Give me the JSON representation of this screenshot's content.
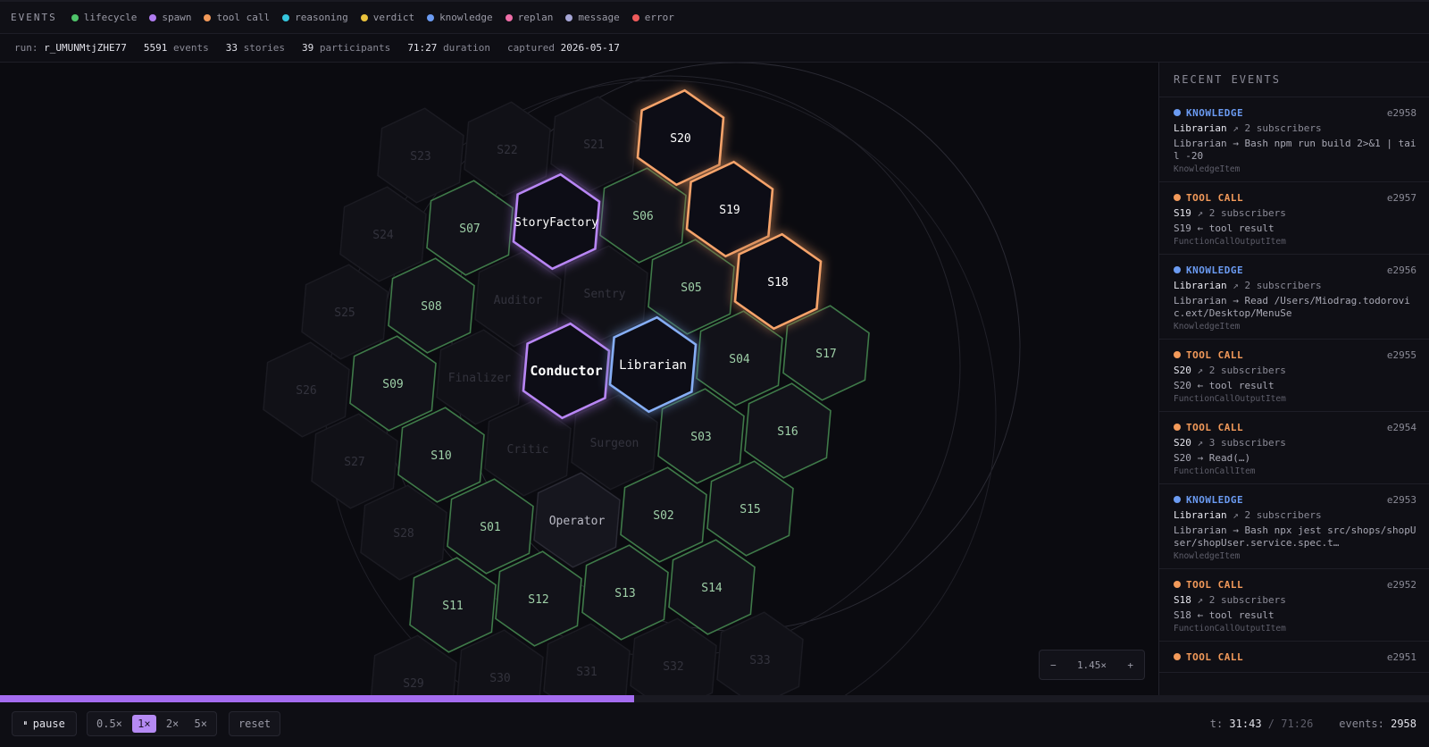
{
  "legend": {
    "title": "EVENTS",
    "items": [
      {
        "label": "lifecycle",
        "color": "#4fc46a"
      },
      {
        "label": "spawn",
        "color": "#b07cf0"
      },
      {
        "label": "tool call",
        "color": "#f39a5a"
      },
      {
        "label": "reasoning",
        "color": "#35c6dd"
      },
      {
        "label": "verdict",
        "color": "#e9c23c"
      },
      {
        "label": "knowledge",
        "color": "#6b9bf2"
      },
      {
        "label": "replan",
        "color": "#ef6ea8"
      },
      {
        "label": "message",
        "color": "#a6a6d6"
      },
      {
        "label": "error",
        "color": "#ef5b5b"
      }
    ]
  },
  "meta": {
    "run_label": "run:",
    "run_id": "r_UMUNMtjZHE77",
    "events_count": "5591",
    "events_label": "events",
    "stories_count": "33",
    "stories_label": "stories",
    "participants_count": "39",
    "participants_label": "participants",
    "duration_value": "71:27",
    "duration_label": "duration",
    "captured_label": "captured",
    "captured_date": "2026-05-17"
  },
  "graph": {
    "nodes": [
      {
        "label": "S23",
        "state": "ghost"
      },
      {
        "label": "S22",
        "state": "ghost"
      },
      {
        "label": "S21",
        "state": "ghost"
      },
      {
        "label": "S20",
        "state": "tool"
      },
      {
        "label": "S24",
        "state": "ghost"
      },
      {
        "label": "S07",
        "state": "active"
      },
      {
        "label": "StoryFactory",
        "state": "spawn"
      },
      {
        "label": "S06",
        "state": "active"
      },
      {
        "label": "S19",
        "state": "tool"
      },
      {
        "label": "S25",
        "state": "ghost"
      },
      {
        "label": "S08",
        "state": "active"
      },
      {
        "label": "Auditor",
        "state": "ghost"
      },
      {
        "label": "Sentry",
        "state": "ghost"
      },
      {
        "label": "S05",
        "state": "active"
      },
      {
        "label": "S18",
        "state": "tool"
      },
      {
        "label": "S26",
        "state": "ghost"
      },
      {
        "label": "S09",
        "state": "active"
      },
      {
        "label": "Finalizer",
        "state": "ghost"
      },
      {
        "label": "Conductor",
        "state": "spawn"
      },
      {
        "label": "Librarian",
        "state": "knowledge"
      },
      {
        "label": "S04",
        "state": "active"
      },
      {
        "label": "S17",
        "state": "active"
      },
      {
        "label": "S27",
        "state": "ghost"
      },
      {
        "label": "S10",
        "state": "active"
      },
      {
        "label": "Critic",
        "state": "ghost"
      },
      {
        "label": "Surgeon",
        "state": "ghost"
      },
      {
        "label": "S03",
        "state": "active"
      },
      {
        "label": "S16",
        "state": "active"
      },
      {
        "label": "S28",
        "state": "ghost"
      },
      {
        "label": "S01",
        "state": "active"
      },
      {
        "label": "Operator",
        "state": "neutral"
      },
      {
        "label": "S02",
        "state": "active"
      },
      {
        "label": "S15",
        "state": "active"
      },
      {
        "label": "S11",
        "state": "active"
      },
      {
        "label": "S12",
        "state": "active"
      },
      {
        "label": "S13",
        "state": "active"
      },
      {
        "label": "S14",
        "state": "active"
      },
      {
        "label": "S29",
        "state": "ghost"
      },
      {
        "label": "S30",
        "state": "ghost"
      },
      {
        "label": "S31",
        "state": "ghost"
      },
      {
        "label": "S32",
        "state": "ghost"
      },
      {
        "label": "S33",
        "state": "ghost"
      }
    ]
  },
  "zoom": {
    "minus": "−",
    "level": "1.45×",
    "plus": "+"
  },
  "recent": {
    "title": "RECENT EVENTS",
    "events": [
      {
        "kind": "KNOWLEDGE",
        "color": "#6b9bf2",
        "id": "e2958",
        "actor": "Librarian",
        "subs": "↗ 2 subscribers",
        "text": "Librarian → Bash npm run build 2>&1 | tail -20",
        "type": "KnowledgeItem",
        "clip": false
      },
      {
        "kind": "TOOL CALL",
        "color": "#f39a5a",
        "id": "e2957",
        "actor": "S19",
        "subs": "↗ 2 subscribers",
        "text": "S19 ← tool result",
        "type": "FunctionCallOutputItem",
        "clip": false
      },
      {
        "kind": "KNOWLEDGE",
        "color": "#6b9bf2",
        "id": "e2956",
        "actor": "Librarian",
        "subs": "↗ 2 subscribers",
        "text": "Librarian → Read /Users/Miodrag.todorovic.ext/Desktop/MenuSe",
        "type": "KnowledgeItem",
        "clip": false
      },
      {
        "kind": "TOOL CALL",
        "color": "#f39a5a",
        "id": "e2955",
        "actor": "S20",
        "subs": "↗ 2 subscribers",
        "text": "S20 ← tool result",
        "type": "FunctionCallOutputItem",
        "clip": false
      },
      {
        "kind": "TOOL CALL",
        "color": "#f39a5a",
        "id": "e2954",
        "actor": "S20",
        "subs": "↗ 3 subscribers",
        "text": "S20 → Read(…)",
        "type": "FunctionCallItem",
        "clip": false
      },
      {
        "kind": "KNOWLEDGE",
        "color": "#6b9bf2",
        "id": "e2953",
        "actor": "Librarian",
        "subs": "↗ 2 subscribers",
        "text": "Librarian → Bash npx jest src/shops/shopUser/shopUser.service.spec.t…",
        "type": "KnowledgeItem",
        "clip": false
      },
      {
        "kind": "TOOL CALL",
        "color": "#f39a5a",
        "id": "e2952",
        "actor": "S18",
        "subs": "↗ 2 subscribers",
        "text": "S18 ← tool result",
        "type": "FunctionCallOutputItem",
        "clip": false
      },
      {
        "kind": "TOOL CALL",
        "color": "#f39a5a",
        "id": "e2951",
        "actor": "",
        "subs": "",
        "text": "",
        "type": "",
        "clip": false
      }
    ]
  },
  "playback": {
    "progress": 0.444,
    "pause_icon": "⏸",
    "pause_label": "pause",
    "speeds": [
      "0.5×",
      "1×",
      "2×",
      "5×"
    ],
    "active_speed": "1×",
    "reset_label": "reset",
    "time_label": "t:",
    "time_current": "31:43",
    "time_sep": "/",
    "time_total": "71:26",
    "events_label": "events:",
    "events_value": "2958"
  }
}
